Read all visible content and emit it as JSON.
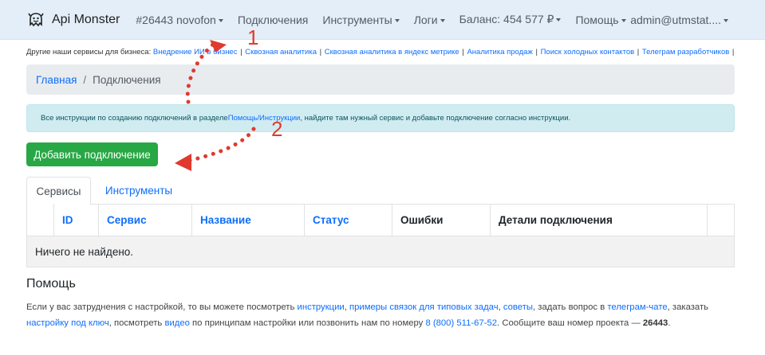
{
  "navbar": {
    "brand": "Api Monster",
    "project": "#26443 novofon",
    "connections": "Подключения",
    "tools": "Инструменты",
    "logs": "Логи",
    "balance": "Баланс: 454 577 ₽",
    "help": "Помощь",
    "user": "admin@utmstat...."
  },
  "services": {
    "prefix": "Другие наши сервисы для бизнеса:",
    "links": [
      "Внедрение ИИ в бизнес",
      "Сквозная аналитика",
      "Сквозная аналитика в яндекс метрике",
      "Аналитика продаж",
      "Поиск холодных контактов",
      "Телеграм разработчиков"
    ],
    "separator": "|"
  },
  "breadcrumb": {
    "home": "Главная",
    "divider": "/",
    "current": "Подключения"
  },
  "alert": {
    "text_before": "Все инструкции по созданию подключений в разделе ",
    "link": "Помощь/Инструкции",
    "text_after": ", найдите там нужный сервис и добавьте подключение согласно инструкции."
  },
  "add_button": "Добавить подключение",
  "tabs": [
    "Сервисы",
    "Инструменты"
  ],
  "table": {
    "columns": [
      "",
      "ID",
      "Сервис",
      "Название",
      "Статус",
      "Ошибки",
      "Детали подключения",
      ""
    ],
    "empty": "Ничего не найдено."
  },
  "help": {
    "title": "Помощь",
    "p1": "Если у вас затруднения с настройкой, то вы можете посмотреть ",
    "link_instructions": "инструкции",
    "p2": ", ",
    "link_examples": "примеры связок для типовых задач",
    "p3": ", ",
    "link_tips": "советы",
    "p4": ", задать вопрос в ",
    "link_telegram": "телеграм-чате",
    "p5": ", заказать ",
    "link_setup": "настройку под ключ",
    "p6": ", посмотреть ",
    "link_video": "видео",
    "p7": " по принципам настройки или позвонить нам по номеру ",
    "link_phone": "8 (800) 511-67-52",
    "p8": ". Сообщите ваш номер проекта — ",
    "project_number": "26443",
    "p9": "."
  },
  "annotations": {
    "label_1": "1",
    "label_2": "2",
    "color": "#e03a2f"
  },
  "colors": {
    "navbar_bg": "#e3eef9",
    "primary_link": "#0d6efd",
    "success": "#28a745",
    "alert_bg": "#d1ecf1"
  }
}
